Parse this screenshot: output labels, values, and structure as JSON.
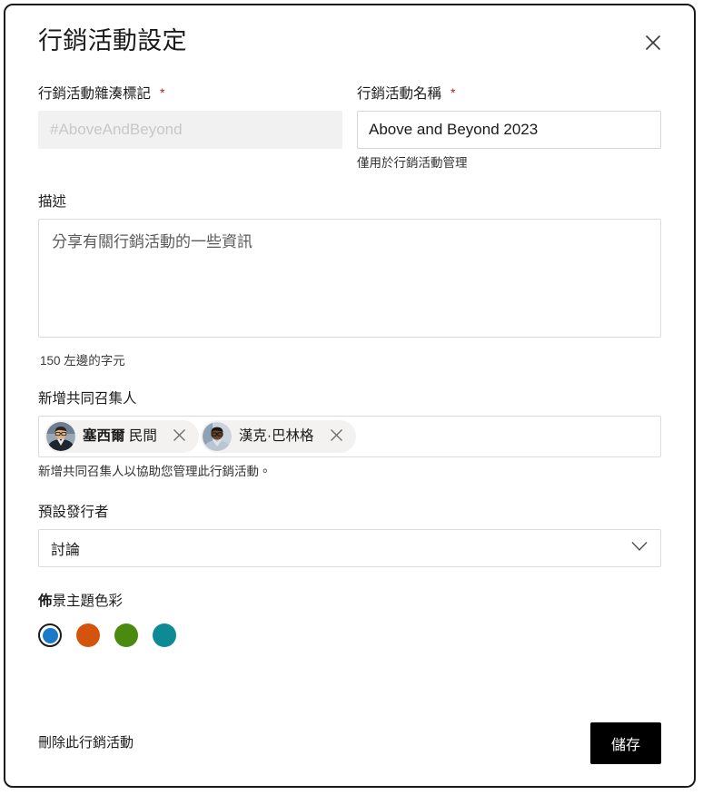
{
  "dialog": {
    "title": "行銷活動設定",
    "close_icon": "close-icon"
  },
  "fields": {
    "hashtag": {
      "label": "行銷活動雜湊標記",
      "required_marker": "*",
      "value": "",
      "placeholder": "#AboveAndBeyond",
      "disabled": true
    },
    "name": {
      "label": "行銷活動名稱",
      "required_marker": "*",
      "value": "Above and Beyond 2023",
      "placeholder": "",
      "hint": "僅用於行銷活動管理"
    },
    "description": {
      "label": "描述",
      "value": "",
      "placeholder": "分享有關行銷活動的一些資訊",
      "char_count": "150 左邊的字元"
    },
    "co_organizers": {
      "label": "新增共同召集人",
      "hint": "新增共同召集人以協助您管理此行銷活動。",
      "people": [
        {
          "name_bold": "塞西爾",
          "name_rest": "民間",
          "avatar": "person-photo-avatar",
          "remove_icon": "close-icon"
        },
        {
          "name_bold": "",
          "name_rest": "漢克·巴林格",
          "avatar": "person-photo-avatar",
          "remove_icon": "close-icon"
        }
      ]
    },
    "default_publisher": {
      "label": "預設發行者",
      "value": "討論",
      "chevron_icon": "chevron-down-icon"
    },
    "theme_color": {
      "label_first": "佈",
      "label_rest": "景主題色彩",
      "swatches": [
        {
          "name": "blue",
          "color": "#1a7ac8",
          "selected": true
        },
        {
          "name": "orange",
          "color": "#d4540e",
          "selected": false
        },
        {
          "name": "green",
          "color": "#4a8a0f",
          "selected": false
        },
        {
          "name": "teal",
          "color": "#0e8a94",
          "selected": false
        }
      ]
    }
  },
  "footer": {
    "delete_label": "刪除此行銷活動",
    "save_label": "儲存"
  }
}
